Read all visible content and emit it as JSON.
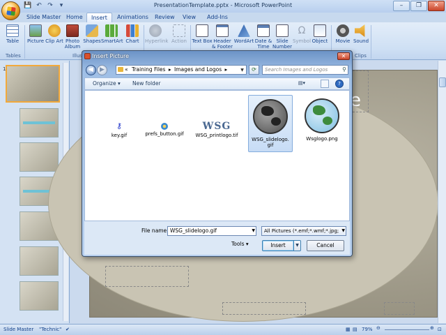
{
  "window": {
    "title": "PresentationTemplate.pptx - Microsoft PowerPoint",
    "controls": [
      "–",
      "❐",
      "✕"
    ]
  },
  "tabs": [
    "Slide Master",
    "Home",
    "Insert",
    "Animations",
    "Review",
    "View",
    "Add-Ins"
  ],
  "active_tab": "Insert",
  "ribbon": {
    "buttons": [
      {
        "label": "Table",
        "icon": "table-icon",
        "enabled": true
      },
      {
        "label": "Picture",
        "icon": "picture-icon",
        "enabled": true
      },
      {
        "label": "Clip Art",
        "icon": "clip-art-icon",
        "enabled": true
      },
      {
        "label": "Photo Album",
        "icon": "photo-album-icon",
        "enabled": true
      },
      {
        "label": "Shapes",
        "icon": "shapes-icon",
        "enabled": true
      },
      {
        "label": "SmartArt",
        "icon": "smartart-icon",
        "enabled": true
      },
      {
        "label": "Chart",
        "icon": "chart-icon",
        "enabled": true
      },
      {
        "label": "Hyperlink",
        "icon": "hyperlink-icon",
        "enabled": false
      },
      {
        "label": "Action",
        "icon": "action-icon",
        "enabled": false
      },
      {
        "label": "Text Box",
        "icon": "text-box-icon",
        "enabled": true
      },
      {
        "label": "Header & Footer",
        "icon": "header-footer-icon",
        "enabled": true
      },
      {
        "label": "WordArt",
        "icon": "wordart-icon",
        "enabled": true
      },
      {
        "label": "Date & Time",
        "icon": "date-time-icon",
        "enabled": true
      },
      {
        "label": "Slide Number",
        "icon": "slide-number-icon",
        "enabled": true
      },
      {
        "label": "Symbol",
        "icon": "symbol-icon",
        "enabled": false
      },
      {
        "label": "Object",
        "icon": "object-icon",
        "enabled": true
      },
      {
        "label": "Movie",
        "icon": "movie-icon",
        "enabled": true
      },
      {
        "label": "Sound",
        "icon": "sound-icon",
        "enabled": true
      }
    ],
    "groups": [
      "Tables",
      "Illus",
      "Clips"
    ]
  },
  "slide_title_fragment": "e",
  "statusbar": {
    "view": "Slide Master",
    "theme": "\"Technic\"",
    "zoom": "79%"
  },
  "dialog": {
    "title": "Insert Picture",
    "address": {
      "prefix": "«",
      "crumbs": [
        "Training Files",
        "Images and Logos"
      ]
    },
    "search_placeholder": "Search Images and Logos",
    "toolbar": {
      "organize": "Organize",
      "new_folder": "New folder"
    },
    "files": [
      {
        "name": "key.gif",
        "kind": "key",
        "selected": false
      },
      {
        "name": "prefs_button.gif",
        "kind": "prefs",
        "selected": false
      },
      {
        "name": "WSG_printlogo.tif",
        "kind": "wsg",
        "selected": false
      },
      {
        "name": "WSG_slidelogo.gif",
        "kind": "globe-gray",
        "selected": true
      },
      {
        "name": "Wsglogo.png",
        "kind": "globe-color",
        "selected": false
      }
    ],
    "wsg_text": "WSG",
    "file_name_label": "File name:",
    "file_name_value": "WSG_slidelogo.gif",
    "file_type_value": "All Pictures (*.emf;*.wmf;*.jpg;",
    "tools_label": "Tools",
    "insert_label": "Insert",
    "cancel_label": "Cancel"
  },
  "colors": {
    "ribbon": "#cfe0f4",
    "selection": "#c7dcf5",
    "accent": "#f2a93b",
    "slide": "#9d9887"
  }
}
